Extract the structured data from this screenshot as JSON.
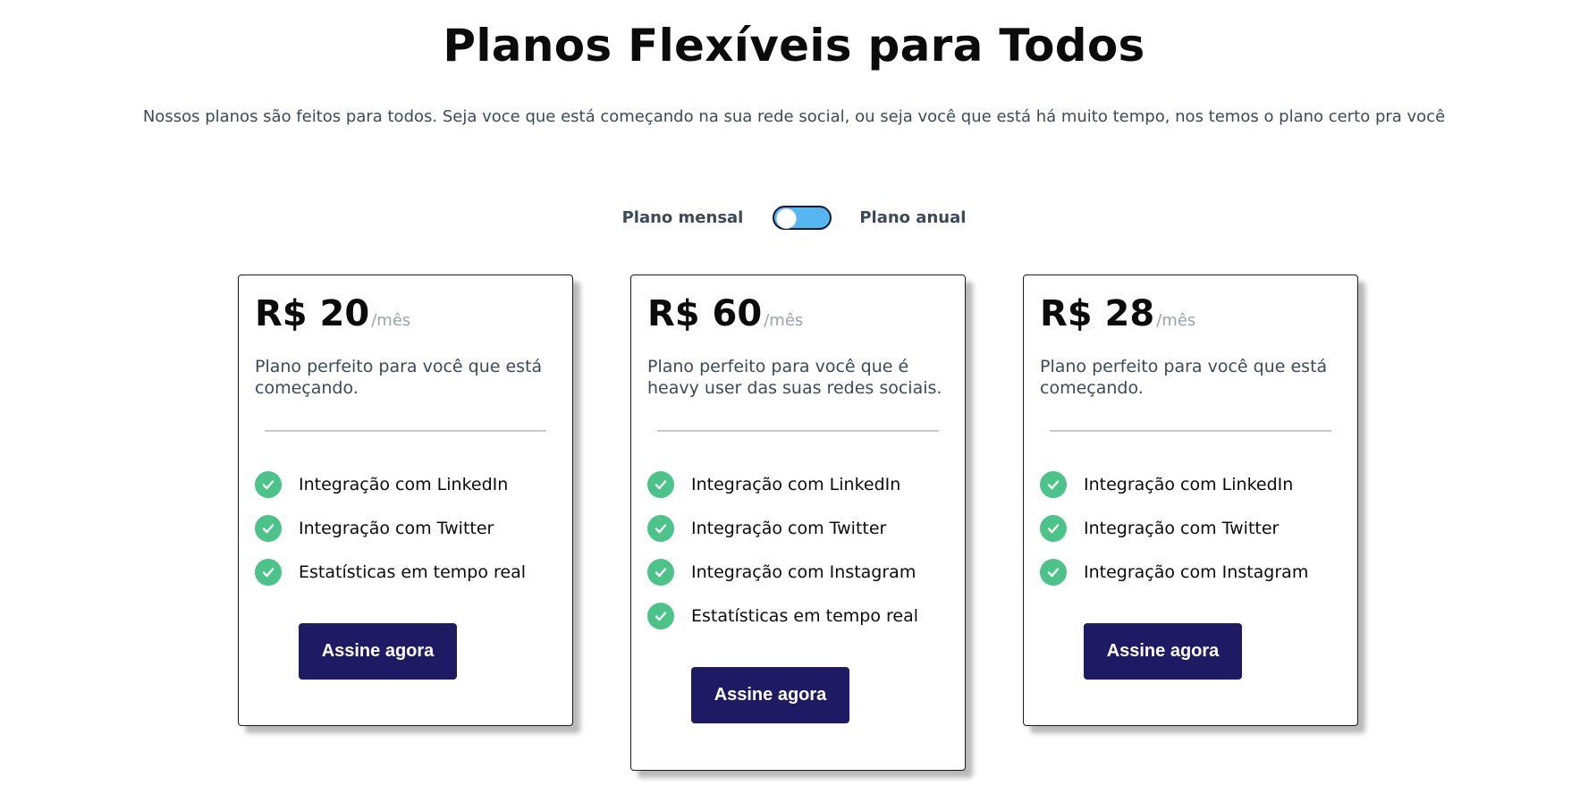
{
  "header": {
    "title": "Planos Flexíveis para Todos",
    "subtitle": "Nossos planos são feitos para todos. Seja voce que está começando na sua rede social, ou seja você que está há muito tempo, nos temos o plano certo pra você"
  },
  "billing_toggle": {
    "monthly_label": "Plano mensal",
    "annual_label": "Plano anual",
    "selected": "Plano mensal"
  },
  "colors": {
    "toggle_track": "#55b6f2",
    "check": "#4cc388",
    "button": "#1e1b64"
  },
  "plans": [
    {
      "price": "R$ 20",
      "period": "/mês",
      "description": "Plano perfeito para você que está começando.",
      "features": [
        "Integração com LinkedIn",
        "Integração com Twitter",
        "Estatísticas em tempo real"
      ],
      "cta": "Assine agora"
    },
    {
      "price": "R$ 60",
      "period": "/mês",
      "description": "Plano perfeito para você que é heavy user das suas redes sociais.",
      "features": [
        "Integração com LinkedIn",
        "Integração com Twitter",
        "Integração com Instagram",
        "Estatísticas em tempo real"
      ],
      "cta": "Assine agora"
    },
    {
      "price": "R$ 28",
      "period": "/mês",
      "description": "Plano perfeito para você que está começando.",
      "features": [
        "Integração com LinkedIn",
        "Integração com Twitter",
        "Integração com Instagram"
      ],
      "cta": "Assine agora"
    }
  ],
  "icons": {
    "feature": "check-circle-icon"
  }
}
